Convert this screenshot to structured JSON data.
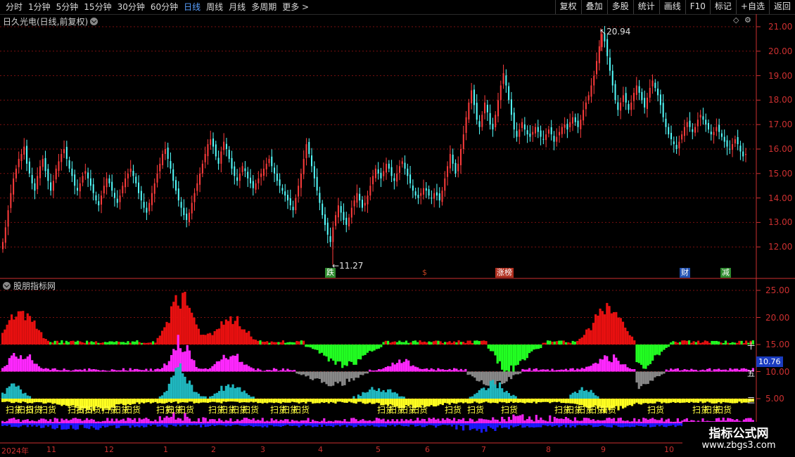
{
  "toolbar": {
    "tabs": [
      "分时",
      "1分钟",
      "5分钟",
      "15分钟",
      "30分钟",
      "60分钟",
      "日线",
      "周线",
      "月线",
      "多周期",
      "更多 >"
    ],
    "active": "日线",
    "buttons": [
      "复权",
      "叠加",
      "多股",
      "统计",
      "画线",
      "F10",
      "标记",
      "+自选",
      "返回"
    ]
  },
  "main_chart": {
    "title": "日久光电(日线,前复权)",
    "y_ticks": [
      "21.00",
      "20.00",
      "19.00",
      "18.00",
      "17.00",
      "16.00",
      "15.00",
      "14.00",
      "13.00",
      "12.00"
    ],
    "high_label": "20.94",
    "low_label": "11.27",
    "markers": [
      {
        "text": "跌",
        "color": "#2e8b2e"
      },
      {
        "text": "$",
        "color": "#c04020"
      },
      {
        "text": "涨榜",
        "color": "#b03020"
      },
      {
        "text": "财",
        "color": "#2050b0"
      },
      {
        "text": "减",
        "color": "#2e8b2e"
      }
    ]
  },
  "indicator": {
    "title": "股朋指标网",
    "y_ticks": [
      "25.00",
      "20.00",
      "15.00",
      "10.00",
      "5.00"
    ],
    "value_badge": "10.76",
    "side_labels": [
      "十",
      "五",
      "三"
    ],
    "scan_text": "扫货"
  },
  "x_axis": {
    "labels": [
      "2024年",
      "11",
      "12",
      "1",
      "2",
      "3",
      "4",
      "5",
      "6",
      "7",
      "8",
      "9",
      "10"
    ]
  },
  "watermark": {
    "title": "指标公式网",
    "url": "www.zbgs3.com"
  },
  "colors": {
    "up": "#ff3c3c",
    "down": "#54ffff",
    "grid": "#7a1010",
    "axis": "#cc3030"
  },
  "chart_data": {
    "type": "candlestick",
    "title": "日久光电(日线,前复权)",
    "ylim": [
      11.5,
      21.5
    ],
    "high": 20.94,
    "low": 11.27,
    "closes": [
      12.2,
      12.8,
      13.5,
      14.2,
      14.8,
      15.2,
      15.6,
      15.8,
      16.1,
      15.4,
      15.0,
      14.6,
      14.3,
      14.9,
      15.3,
      15.6,
      15.1,
      14.7,
      14.3,
      14.7,
      15.2,
      15.5,
      15.8,
      16.0,
      15.6,
      15.2,
      14.9,
      14.5,
      14.3,
      14.6,
      14.9,
      15.1,
      14.8,
      14.5,
      14.2,
      13.9,
      13.7,
      14.1,
      14.5,
      14.8,
      14.6,
      14.3,
      14.0,
      13.8,
      14.1,
      14.5,
      14.8,
      15.0,
      15.2,
      14.9,
      14.6,
      14.2,
      13.9,
      13.6,
      13.4,
      13.8,
      14.2,
      14.6,
      15.0,
      15.4,
      15.8,
      16.0,
      15.6,
      15.2,
      14.7,
      14.3,
      13.9,
      13.6,
      13.3,
      13.1,
      13.4,
      13.8,
      14.2,
      14.6,
      15.0,
      15.4,
      15.8,
      16.2,
      16.4,
      16.1,
      15.7,
      15.4,
      15.9,
      16.3,
      16.0,
      15.6,
      15.2,
      14.9,
      14.7,
      15.0,
      15.3,
      15.1,
      14.8,
      14.6,
      14.4,
      14.6,
      14.8,
      15.0,
      15.2,
      15.4,
      15.6,
      15.3,
      15.0,
      14.7,
      14.5,
      14.3,
      14.1,
      13.9,
      13.7,
      13.5,
      14.0,
      14.5,
      15.0,
      15.6,
      16.2,
      15.8,
      15.3,
      14.8,
      14.3,
      13.8,
      13.3,
      12.9,
      12.5,
      12.2,
      12.8,
      13.3,
      13.7,
      13.4,
      13.1,
      12.9,
      13.2,
      13.6,
      13.9,
      14.2,
      13.9,
      13.6,
      13.8,
      14.1,
      14.5,
      14.9,
      15.2,
      15.0,
      14.8,
      15.1,
      15.4,
      15.2,
      14.9,
      14.7,
      15.0,
      15.3,
      15.5,
      15.2,
      14.9,
      14.6,
      14.3,
      14.1,
      14.0,
      14.2,
      14.4,
      14.3,
      14.1,
      14.0,
      14.2,
      14.1,
      13.9,
      14.3,
      14.8,
      15.3,
      15.8,
      15.4,
      15.0,
      15.4,
      16.0,
      16.6,
      17.3,
      17.9,
      18.4,
      17.8,
      17.2,
      16.9,
      17.4,
      17.9,
      17.5,
      17.0,
      16.8,
      17.4,
      18.0,
      18.6,
      19.1,
      18.6,
      18.0,
      17.4,
      16.8,
      16.5,
      16.8,
      17.1,
      16.8,
      16.6,
      16.5,
      16.7,
      16.9,
      16.7,
      16.5,
      16.4,
      16.6,
      16.8,
      16.6,
      16.3,
      16.5,
      16.7,
      16.9,
      17.0,
      16.8,
      17.1,
      17.3,
      17.1,
      16.9,
      17.2,
      17.6,
      17.9,
      18.2,
      18.6,
      19.0,
      19.6,
      20.2,
      20.7,
      20.4,
      19.8,
      19.2,
      18.6,
      18.0,
      17.6,
      17.9,
      18.2,
      17.9,
      17.6,
      17.9,
      18.3,
      18.6,
      18.3,
      18.0,
      17.7,
      18.1,
      18.5,
      18.8,
      18.5,
      18.2,
      17.8,
      17.3,
      16.9,
      16.6,
      16.4,
      16.2,
      16.0,
      16.3,
      16.6,
      16.9,
      17.1,
      16.9,
      16.7,
      16.9,
      17.2,
      17.4,
      17.2,
      17.0,
      16.8,
      16.6,
      16.7,
      16.9,
      16.7,
      16.5,
      16.3,
      16.1,
      16.0,
      16.2,
      16.4,
      16.2,
      15.9,
      15.7,
      15.8
    ]
  }
}
